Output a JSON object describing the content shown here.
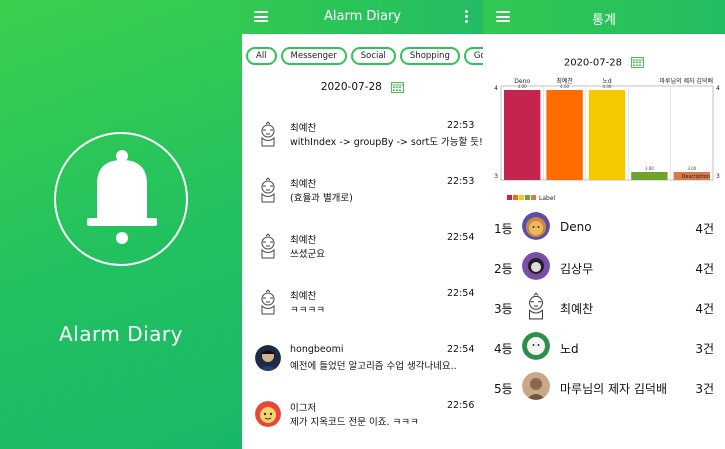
{
  "splash": {
    "app_name": "Alarm Diary"
  },
  "list_screen": {
    "title": "Alarm Diary",
    "chips": [
      "All",
      "Messenger",
      "Social",
      "Shopping",
      "Go"
    ],
    "date": "2020-07-28",
    "messages": [
      {
        "sender": "최예찬",
        "time": "22:53",
        "text": "withIndex -> groupBy -> sort도 가능할 듯!",
        "avatar": "doodle-avatar"
      },
      {
        "sender": "최예찬",
        "time": "22:53",
        "text": "(효율과 별개로)",
        "avatar": "doodle-avatar"
      },
      {
        "sender": "최예찬",
        "time": "22:54",
        "text": "쓰셨군요",
        "avatar": "doodle-avatar"
      },
      {
        "sender": "최예찬",
        "time": "22:54",
        "text": "ㅋㅋㅋㅋ",
        "avatar": "doodle-avatar"
      },
      {
        "sender": "hongbeomi",
        "time": "22:54",
        "text": "예전에 들었던 알고리즘 수업 생각나네요..",
        "avatar": "photo-avatar"
      },
      {
        "sender": "이그저",
        "time": "22:56",
        "text": "제가 지옥코드 전문 이죠. ㅋㅋㅋ",
        "avatar": "character-avatar"
      }
    ]
  },
  "stats_screen": {
    "title": "통계",
    "date": "2020-07-28",
    "chart_data": {
      "type": "bar",
      "categories": [
        "Deno",
        "최예찬",
        "노d",
        "",
        "마루님의 제자 김덕배"
      ],
      "values": [
        4,
        4,
        4,
        3,
        3
      ],
      "bar_labels": [
        "4.00",
        "4.00",
        "4.00",
        "3.00",
        "3.00"
      ],
      "ylim": [
        3,
        4
      ],
      "y_ticks": [
        "4",
        "3"
      ],
      "right_ticks": [
        "4",
        "3"
      ],
      "legend": [
        "Label"
      ],
      "description": "Description",
      "colors": [
        "#c4254f",
        "#ff6d00",
        "#f5c800",
        "#6fa32d",
        "#d97a4a"
      ]
    },
    "ranking": [
      {
        "rank": "1등",
        "name": "Deno",
        "count": "4건",
        "avatar": "lion-avatar"
      },
      {
        "rank": "2등",
        "name": "김상무",
        "count": "4건",
        "avatar": "purple-avatar"
      },
      {
        "rank": "3등",
        "name": "최예찬",
        "count": "4건",
        "avatar": "doodle-avatar"
      },
      {
        "rank": "4등",
        "name": "노d",
        "count": "3건",
        "avatar": "green-avatar"
      },
      {
        "rank": "5등",
        "name": "마루님의 제자 김덕배",
        "count": "3건",
        "avatar": "photo-avatar"
      }
    ]
  },
  "colors": {
    "accent": "#22bd62",
    "chip_border": "#33c25a"
  }
}
